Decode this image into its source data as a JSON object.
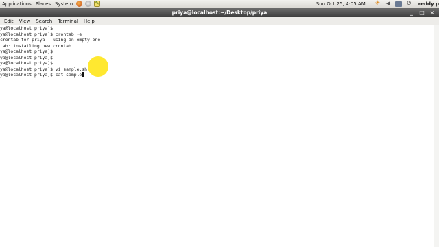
{
  "top_panel": {
    "menus": [
      "Applications",
      "Places",
      "System"
    ],
    "launchers": [
      {
        "name": "firefox-icon"
      },
      {
        "name": "mail-icon"
      },
      {
        "name": "notes-icon"
      }
    ],
    "clock": "Sun Oct 25,  4:05 AM",
    "user": "reddy p",
    "tray_icons": [
      "weather-icon",
      "volume-icon",
      "network-icon",
      "power-icon"
    ]
  },
  "window": {
    "title": "priya@localhost:~/Desktop/priya"
  },
  "menu_bar": {
    "items": [
      "Edit",
      "View",
      "Search",
      "Terminal",
      "Help"
    ]
  },
  "terminal": {
    "lines": [
      "ya@localhost priya]$",
      "ya@localhost priya]$ crontab -e",
      "crontab for priya - using an empty one",
      "tab: installing new crontab",
      "ya@localhost priya]$",
      "ya@localhost priya]$",
      "ya@localhost priya]$",
      "ya@localhost priya]$ vi sample.sh"
    ],
    "current_prompt": "ya@localhost priya]$ cat sample"
  }
}
